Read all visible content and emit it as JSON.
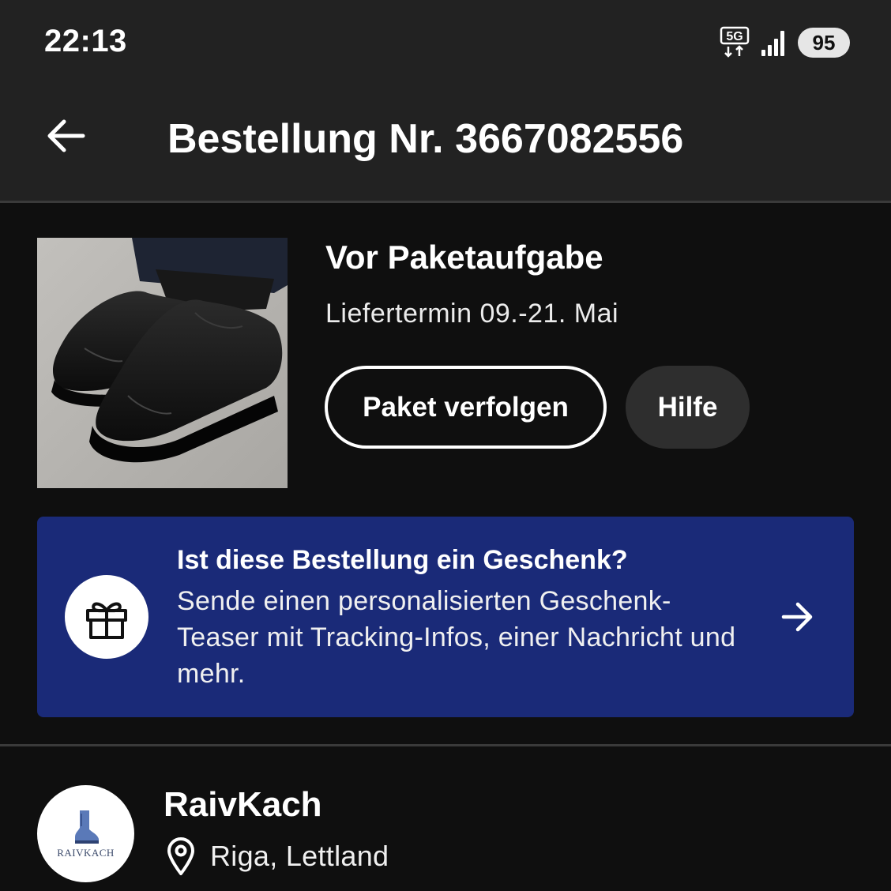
{
  "status_bar": {
    "time": "22:13",
    "network_label": "5G",
    "battery_level": "95",
    "icons": [
      "5g-data-icon",
      "cellular-signal-icon",
      "battery-icon"
    ]
  },
  "header": {
    "back_icon": "arrow-left-icon",
    "title": "Bestellung Nr. 3667082556"
  },
  "order": {
    "product_image": "black-tabi-slip-on-shoes",
    "status": "Vor Paketaufgabe",
    "delivery": "Liefertermin 09.-21. Mai",
    "track_button": "Paket verfolgen",
    "help_button": "Hilfe"
  },
  "gift_banner": {
    "icon": "gift-icon",
    "title": "Ist diese Bestellung ein Geschenk?",
    "description": "Sende einen personalisierten Geschenk-Teaser mit Tracking-Infos, einer Nachricht und mehr.",
    "arrow_icon": "arrow-right-icon",
    "background_color": "#1a2a78"
  },
  "seller": {
    "name": "RaivKach",
    "logo_text": "RAIVKACH",
    "location_icon": "location-pin-icon",
    "location": "Riga, Lettland"
  },
  "colors": {
    "background": "#0f0f0f",
    "top_bar": "#222222",
    "help_button_bg": "#2e2e2e",
    "text": "#ffffff"
  }
}
